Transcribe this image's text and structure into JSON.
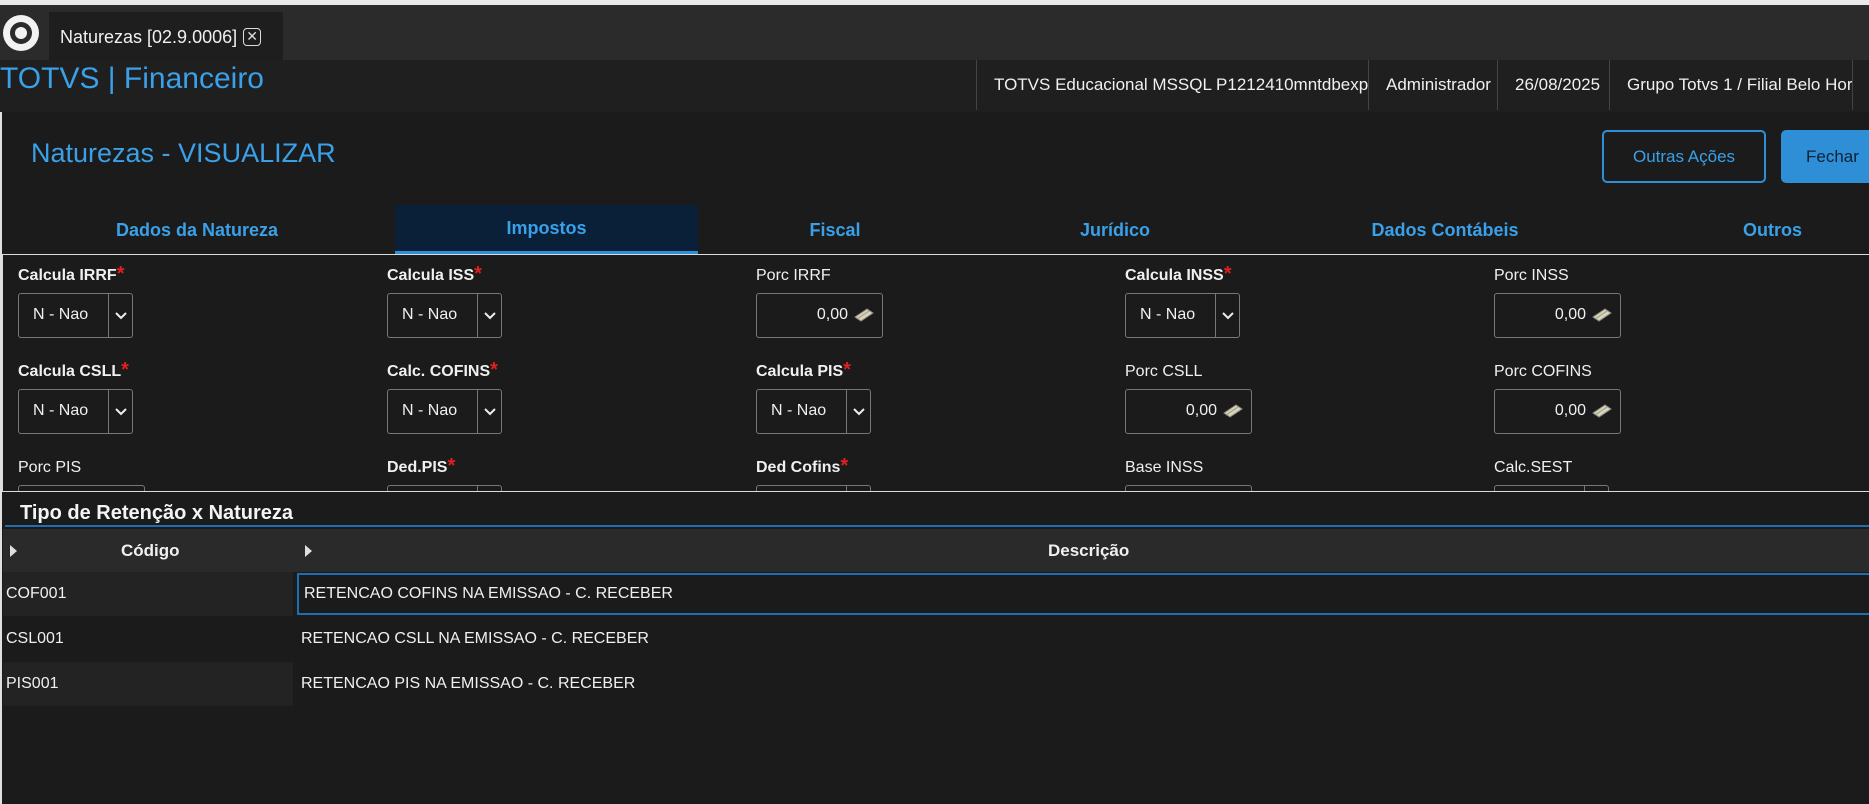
{
  "window_tab": {
    "title": "Naturezas [02.9.0006]",
    "close_icon": "close-icon"
  },
  "header": {
    "app_title": "TOTVS | Financeiro",
    "info": [
      "TOTVS Educacional MSSQL P1212410mntdbexp",
      "Administrador",
      "26/08/2025",
      "Grupo Totvs 1 / Filial Belo Hor"
    ]
  },
  "page": {
    "title": "Naturezas - VISUALIZAR",
    "outras_acoes": "Outras Ações",
    "fechar": "Fechar"
  },
  "tabs": [
    "Dados da Natureza",
    "Impostos",
    "Fiscal",
    "Jurídico",
    "Dados Contábeis",
    "Outros"
  ],
  "active_tab": "Impostos",
  "form": {
    "calc_irrf": {
      "label": "Calcula IRRF",
      "value": "N - Nao",
      "required": "*"
    },
    "calc_iss": {
      "label": "Calcula ISS",
      "value": "N - Nao",
      "required": "*"
    },
    "porc_irrf": {
      "label": "Porc IRRF",
      "value": "0,00"
    },
    "calc_inss": {
      "label": "Calcula INSS",
      "value": "N - Nao",
      "required": "*"
    },
    "porc_inss": {
      "label": "Porc INSS",
      "value": "0,00"
    },
    "calc_csll": {
      "label": "Calcula CSLL",
      "value": "N - Nao",
      "required": "*"
    },
    "calc_cofins": {
      "label": "Calc. COFINS",
      "value": "N - Nao",
      "required": "*"
    },
    "calc_pis": {
      "label": "Calcula PIS",
      "value": "N - Nao",
      "required": "*"
    },
    "porc_csll": {
      "label": "Porc CSLL",
      "value": "0,00"
    },
    "porc_cofins": {
      "label": "Porc COFINS",
      "value": "0,00"
    },
    "porc_pis": {
      "label": "Porc PIS"
    },
    "ded_pis": {
      "label": "Ded.PIS",
      "required": "*"
    },
    "ded_cofins": {
      "label": "Ded Cofins",
      "required": "*"
    },
    "base_inss": {
      "label": "Base INSS"
    },
    "calc_sest": {
      "label": "Calc.SEST"
    }
  },
  "retencao": {
    "title": "Tipo de Retenção x Natureza",
    "columns": [
      "Código",
      "Descrição"
    ],
    "rows": [
      {
        "codigo": "COF001",
        "descricao": "RETENCAO COFINS NA EMISSAO - C. RECEBER"
      },
      {
        "codigo": "CSL001",
        "descricao": "RETENCAO CSLL NA EMISSAO - C. RECEBER"
      },
      {
        "codigo": "PIS001",
        "descricao": "RETENCAO PIS NA EMISSAO - C. RECEBER"
      }
    ]
  },
  "colors": {
    "accent": "#3aa0e8",
    "required": "#e02020",
    "background": "#1b1b1b"
  }
}
